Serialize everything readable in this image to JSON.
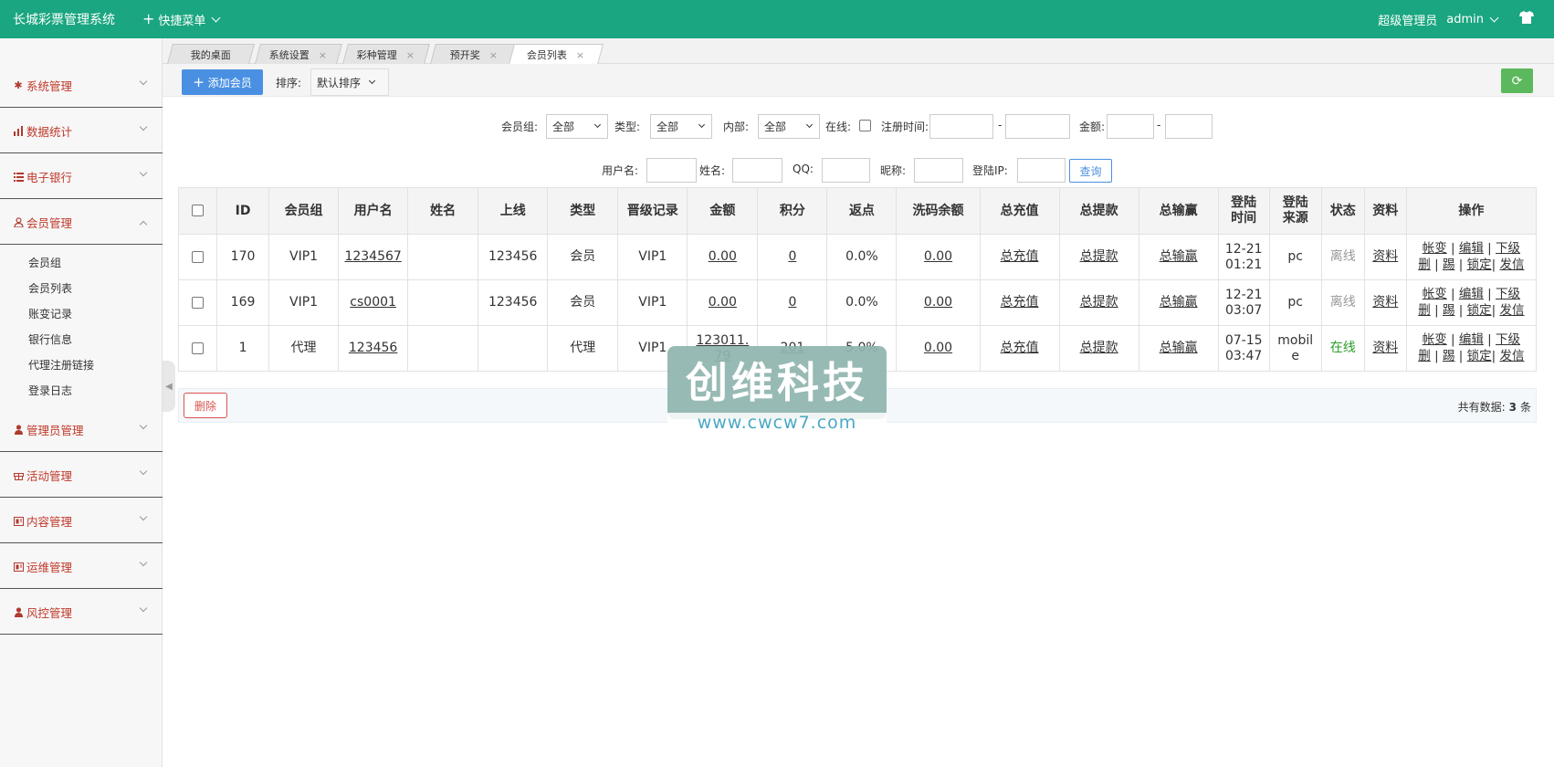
{
  "topbar": {
    "title": "长城彩票管理系统",
    "quick_menu": "快捷菜单",
    "role": "超级管理员",
    "username": "admin"
  },
  "sidebar": {
    "menus": [
      {
        "label": "系统管理",
        "icon": "gear-icon"
      },
      {
        "label": "数据统计",
        "icon": "bar-chart-icon"
      },
      {
        "label": "电子银行",
        "icon": "list-icon"
      },
      {
        "label": "会员管理",
        "icon": "user-icon",
        "expanded": true
      },
      {
        "label": "管理员管理",
        "icon": "person-icon"
      },
      {
        "label": "活动管理",
        "icon": "gift-icon"
      },
      {
        "label": "内容管理",
        "icon": "book-icon"
      },
      {
        "label": "运维管理",
        "icon": "book-icon"
      },
      {
        "label": "风控管理",
        "icon": "person-icon"
      }
    ],
    "submenu": [
      "会员组",
      "会员列表",
      "账变记录",
      "银行信息",
      "代理注册链接",
      "登录日志"
    ]
  },
  "tabs": [
    {
      "label": "我的桌面",
      "closable": false
    },
    {
      "label": "系统设置",
      "closable": true
    },
    {
      "label": "彩种管理",
      "closable": true
    },
    {
      "label": "预开奖",
      "closable": true
    },
    {
      "label": "会员列表",
      "closable": true,
      "active": true
    }
  ],
  "toolbar": {
    "add_label": "添加会员",
    "sort_label": "排序:",
    "sort_value": "默认排序"
  },
  "filters": {
    "group_label": "会员组:",
    "group_value": "全部",
    "type_label": "类型:",
    "type_value": "全部",
    "internal_label": "内部:",
    "internal_value": "全部",
    "online_label": "在线:",
    "regtime_label": "注册时间:",
    "dash": "-",
    "amount_label": "金额:",
    "username_label": "用户名:",
    "name_label": "姓名:",
    "qq_label": "QQ:",
    "nickname_label": "昵称:",
    "loginip_label": "登陆IP:",
    "query_label": "查询"
  },
  "table": {
    "headers": [
      "ID",
      "会员组",
      "用户名",
      "姓名",
      "上线",
      "类型",
      "晋级记录",
      "金额",
      "积分",
      "返点",
      "洗码余额",
      "总充值",
      "总提款",
      "总输赢",
      "登陆时间",
      "登陆来源",
      "状态",
      "资料",
      "操作"
    ],
    "rows": [
      {
        "id": "170",
        "group": "VIP1",
        "username": "1234567",
        "name": "",
        "upline": "123456",
        "type": "会员",
        "promo": "VIP1",
        "amount": "0.00",
        "points": "0",
        "rebate": "0.0%",
        "wash": "0.00",
        "recharge": "总充值",
        "withdraw": "总提款",
        "winloss": "总输赢",
        "login_time": "12-21 01:21",
        "source": "pc",
        "status": "离线",
        "status_color": "#999999",
        "profile": "资料"
      },
      {
        "id": "169",
        "group": "VIP1",
        "username": "cs0001",
        "name": "",
        "upline": "123456",
        "type": "会员",
        "promo": "VIP1",
        "amount": "0.00",
        "points": "0",
        "rebate": "0.0%",
        "wash": "0.00",
        "recharge": "总充值",
        "withdraw": "总提款",
        "winloss": "总输赢",
        "login_time": "12-21 03:07",
        "source": "pc",
        "status": "离线",
        "status_color": "#999999",
        "profile": "资料"
      },
      {
        "id": "1",
        "group": "代理",
        "username": "123456",
        "name": "",
        "upline": "",
        "type": "代理",
        "promo": "VIP1",
        "amount": "123011.79",
        "points": "201",
        "rebate": "5.0%",
        "wash": "0.00",
        "recharge": "总充值",
        "withdraw": "总提款",
        "winloss": "总输赢",
        "login_time": "07-15 03:47",
        "source": "mobile",
        "status": "在线",
        "status_color": "#2a9d2a",
        "profile": "资料"
      }
    ],
    "ops": {
      "account": "帐变",
      "edit": "编辑",
      "sub": "下级",
      "delete": "删",
      "kick": "踢",
      "lock": "锁定",
      "message": "发信",
      "sep": "|"
    }
  },
  "footer": {
    "delete_label": "删除",
    "total_prefix": "共有数据:",
    "total_count": "3",
    "total_suffix": "条"
  },
  "watermark": {
    "text": "创维科技",
    "url": "www.cwcw7.com"
  }
}
